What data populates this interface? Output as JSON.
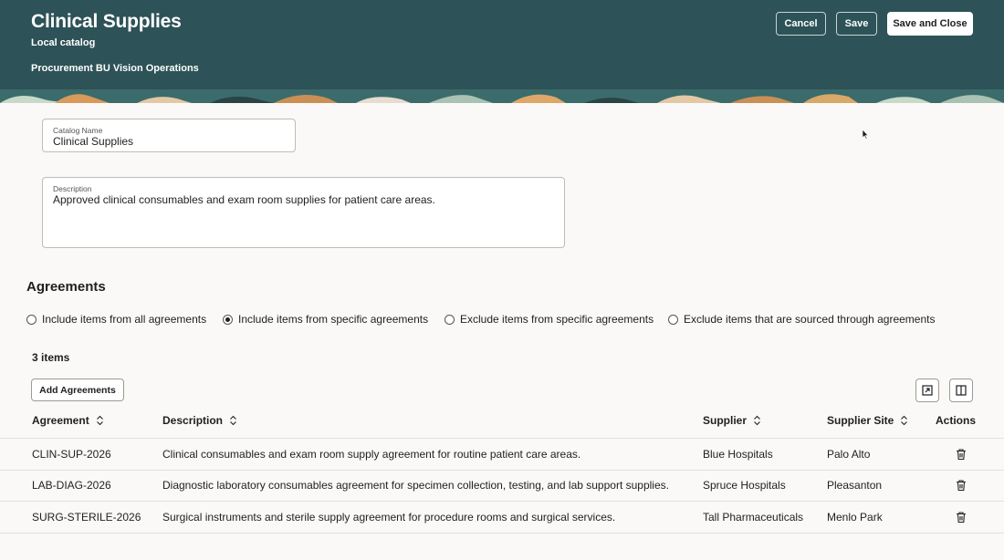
{
  "header": {
    "title": "Clinical Supplies",
    "subtitle": "Local catalog",
    "business_unit": "Procurement BU Vision Operations",
    "cancel_label": "Cancel",
    "save_label": "Save",
    "save_close_label": "Save and Close",
    "background_color": "#2d5257"
  },
  "form": {
    "catalog_name_label": "Catalog Name",
    "catalog_name_value": "Clinical Supplies",
    "description_label": "Description",
    "description_value": "Approved clinical consumables and exam room supplies for patient care areas."
  },
  "agreements": {
    "title": "Agreements",
    "options": [
      {
        "label": "Include items from all agreements",
        "checked": false
      },
      {
        "label": "Include items from specific agreements",
        "checked": true
      },
      {
        "label": "Exclude items from specific agreements",
        "checked": false
      },
      {
        "label": "Exclude items that are sourced through agreements",
        "checked": false
      }
    ],
    "count_text": "3 items",
    "add_button_label": "Add Agreements",
    "icons": [
      "detach-icon",
      "columns-icon"
    ]
  },
  "table": {
    "columns": [
      "Agreement",
      "Description",
      "Supplier",
      "Supplier Site",
      "Actions"
    ],
    "rows": [
      {
        "agreement": "CLIN-SUP-2026",
        "description": "Clinical consumables and exam room supply agreement for routine patient care areas.",
        "supplier": "Blue Hospitals",
        "site": "Palo Alto"
      },
      {
        "agreement": "LAB-DIAG-2026",
        "description": "Diagnostic laboratory consumables agreement for specimen collection, testing, and lab support supplies.",
        "supplier": "Spruce Hospitals",
        "site": "Pleasanton"
      },
      {
        "agreement": "SURG-STERILE-2026",
        "description": "Surgical instruments and sterile supply agreement for procedure rooms and surgical services.",
        "supplier": "Tall Pharmaceuticals",
        "site": "Menlo Park"
      }
    ]
  }
}
